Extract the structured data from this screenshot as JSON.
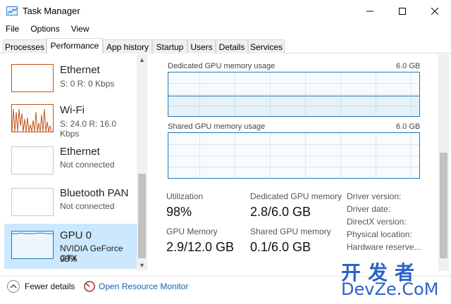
{
  "window": {
    "title": "Task Manager"
  },
  "menu": [
    "File",
    "Options",
    "View"
  ],
  "tabs": [
    "Processes",
    "Performance",
    "App history",
    "Startup",
    "Users",
    "Details",
    "Services"
  ],
  "active_tab": "Performance",
  "resources": [
    {
      "title": "Ethernet",
      "sub": "S: 0 R: 0 Kbps"
    },
    {
      "title": "Wi-Fi",
      "sub": "S: 24.0 R: 16.0 Kbps"
    },
    {
      "title": "Ethernet",
      "sub": "Not connected"
    },
    {
      "title": "Bluetooth PAN",
      "sub": "Not connected"
    },
    {
      "title": "GPU 0",
      "sub": "NVIDIA GeForce GTX",
      "sub2": "98%"
    }
  ],
  "graphs": {
    "dedicated": {
      "label": "Dedicated GPU memory usage",
      "max": "6.0 GB"
    },
    "shared": {
      "label": "Shared GPU memory usage",
      "max": "6.0 GB"
    }
  },
  "stats": {
    "utilization": {
      "label": "Utilization",
      "value": "98%"
    },
    "dedicated": {
      "label": "Dedicated GPU memory",
      "value": "2.8/6.0 GB"
    },
    "gpu_memory": {
      "label": "GPU Memory",
      "value": "2.9/12.0 GB"
    },
    "shared": {
      "label": "Shared GPU memory",
      "value": "0.1/6.0 GB"
    }
  },
  "info_labels": [
    "Driver version:",
    "Driver date:",
    "DirectX version:",
    "Physical location:",
    "Hardware reserve..."
  ],
  "footer": {
    "fewer_details": "Fewer details",
    "open_resource_monitor": "Open Resource Monitor"
  },
  "watermark": {
    "cn": "开发者",
    "en": "DevZe.CoM"
  },
  "colors": {
    "accent": "#1f7ab8",
    "selected_bg": "#cce8ff",
    "wifi_orange": "#c1551c",
    "link": "#1a5fb4"
  },
  "icons": {
    "app": "task-manager-icon",
    "fewer": "chevron-up-icon",
    "orm": "resource-monitor-icon"
  }
}
